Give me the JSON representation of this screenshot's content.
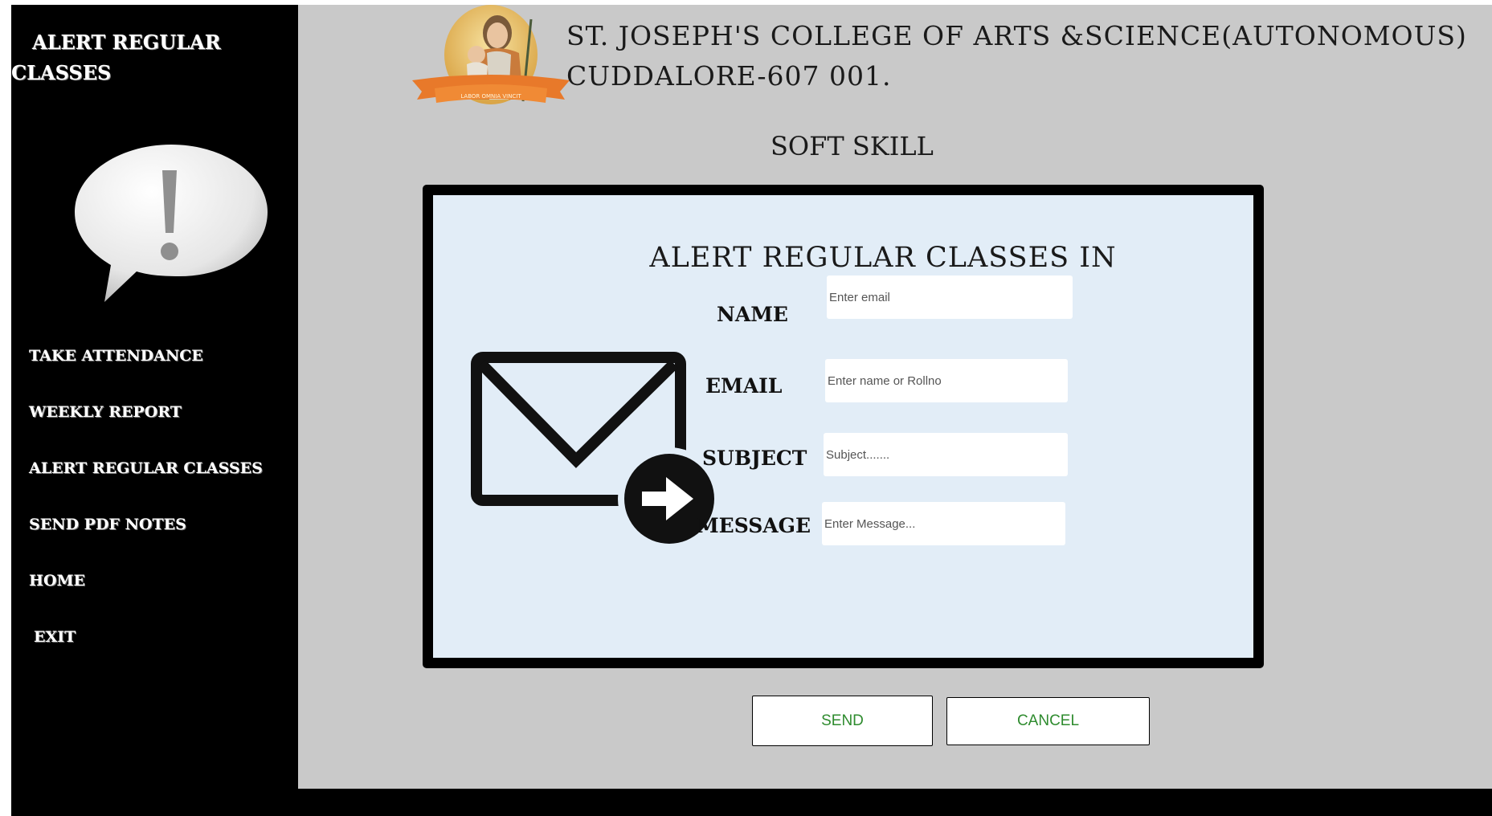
{
  "sidebar": {
    "title_line1": "ALERT REGULAR",
    "title_line2": "CLASSES",
    "illustration": "exclamation-speech-bubble-icon",
    "items": [
      {
        "label": "TAKE ATTENDANCE"
      },
      {
        "label": "WEEKLY REPORT"
      },
      {
        "label": "ALERT REGULAR CLASSES"
      },
      {
        "label": "SEND PDF NOTES"
      },
      {
        "label": "HOME"
      },
      {
        "label": "EXIT"
      }
    ]
  },
  "header": {
    "logo": "college-emblem-logo",
    "college_line1": "ST. JOSEPH'S COLLEGE OF ARTS &SCIENCE(AUTONOMOUS)",
    "college_line2": "CUDDALORE-607 001.",
    "subtitle": "SOFT SKILL",
    "logo_motto": "LABOR OMNIA VINCIT"
  },
  "form": {
    "title": "ALERT REGULAR CLASSES IN MAIL",
    "icon": "mail-send-icon",
    "fields": {
      "name": {
        "label": "NAME",
        "placeholder": "Enter email"
      },
      "email": {
        "label": "EMAIL",
        "placeholder": "Enter name or Rollno"
      },
      "subject": {
        "label": "SUBJECT",
        "placeholder": "Subject......."
      },
      "message": {
        "label": "MESSAGE",
        "placeholder": "Enter Message..."
      }
    },
    "send_label": "SEND",
    "cancel_label": "CANCEL"
  },
  "colors": {
    "sidebar_bg": "#000000",
    "main_bg": "#c9c9c9",
    "panel_bg": "#e2edf7",
    "button_text": "#2e8b2e"
  }
}
